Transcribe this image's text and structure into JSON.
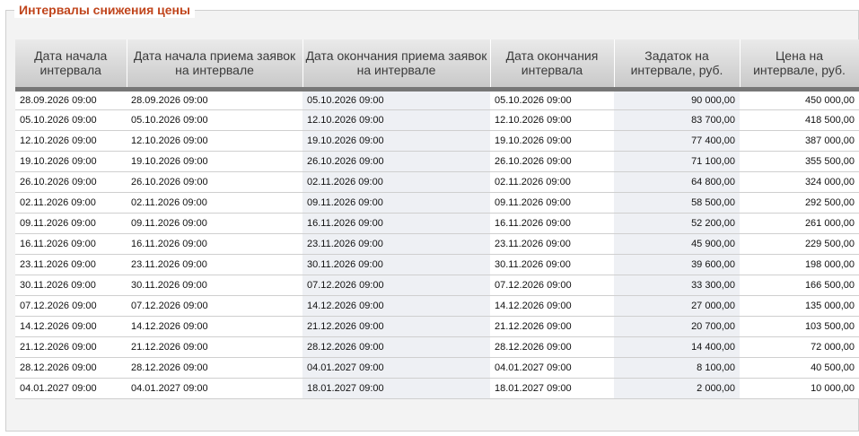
{
  "section": {
    "title": "Интервалы снижения цены"
  },
  "table": {
    "headers": [
      "Дата начала интервала",
      "Дата начала приема заявок на интервале",
      "Дата окончания приема заявок на интервале",
      "Дата окончания интервала",
      "Задаток на интервале, руб.",
      "Цена на интервале, руб."
    ],
    "rows": [
      [
        "28.09.2026 09:00",
        "28.09.2026 09:00",
        "05.10.2026 09:00",
        "05.10.2026 09:00",
        "90 000,00",
        "450 000,00"
      ],
      [
        "05.10.2026 09:00",
        "05.10.2026 09:00",
        "12.10.2026 09:00",
        "12.10.2026 09:00",
        "83 700,00",
        "418 500,00"
      ],
      [
        "12.10.2026 09:00",
        "12.10.2026 09:00",
        "19.10.2026 09:00",
        "19.10.2026 09:00",
        "77 400,00",
        "387 000,00"
      ],
      [
        "19.10.2026 09:00",
        "19.10.2026 09:00",
        "26.10.2026 09:00",
        "26.10.2026 09:00",
        "71 100,00",
        "355 500,00"
      ],
      [
        "26.10.2026 09:00",
        "26.10.2026 09:00",
        "02.11.2026 09:00",
        "02.11.2026 09:00",
        "64 800,00",
        "324 000,00"
      ],
      [
        "02.11.2026 09:00",
        "02.11.2026 09:00",
        "09.11.2026 09:00",
        "09.11.2026 09:00",
        "58 500,00",
        "292 500,00"
      ],
      [
        "09.11.2026 09:00",
        "09.11.2026 09:00",
        "16.11.2026 09:00",
        "16.11.2026 09:00",
        "52 200,00",
        "261 000,00"
      ],
      [
        "16.11.2026 09:00",
        "16.11.2026 09:00",
        "23.11.2026 09:00",
        "23.11.2026 09:00",
        "45 900,00",
        "229 500,00"
      ],
      [
        "23.11.2026 09:00",
        "23.11.2026 09:00",
        "30.11.2026 09:00",
        "30.11.2026 09:00",
        "39 600,00",
        "198 000,00"
      ],
      [
        "30.11.2026 09:00",
        "30.11.2026 09:00",
        "07.12.2026 09:00",
        "07.12.2026 09:00",
        "33 300,00",
        "166 500,00"
      ],
      [
        "07.12.2026 09:00",
        "07.12.2026 09:00",
        "14.12.2026 09:00",
        "14.12.2026 09:00",
        "27 000,00",
        "135 000,00"
      ],
      [
        "14.12.2026 09:00",
        "14.12.2026 09:00",
        "21.12.2026 09:00",
        "21.12.2026 09:00",
        "20 700,00",
        "103 500,00"
      ],
      [
        "21.12.2026 09:00",
        "21.12.2026 09:00",
        "28.12.2026 09:00",
        "28.12.2026 09:00",
        "14 400,00",
        "72 000,00"
      ],
      [
        "28.12.2026 09:00",
        "28.12.2026 09:00",
        "04.01.2027 09:00",
        "04.01.2027 09:00",
        "8 100,00",
        "40 500,00"
      ],
      [
        "04.01.2027 09:00",
        "04.01.2027 09:00",
        "18.01.2027 09:00",
        "18.01.2027 09:00",
        "2 000,00",
        "10 000,00"
      ]
    ]
  }
}
